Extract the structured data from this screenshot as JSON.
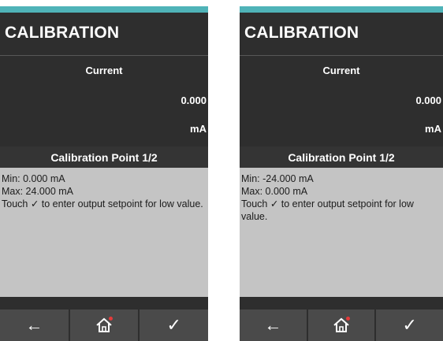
{
  "screens": [
    {
      "title": "CALIBRATION",
      "current_label": "Current",
      "current_value": "0.000",
      "current_unit": "mA",
      "calibration_point": "Calibration Point 1/2",
      "info": {
        "min": "Min: 0.000 mA",
        "max": "Max: 24.000 mA",
        "instruction": "Touch ✓ to enter output setpoint for low value."
      }
    },
    {
      "title": "CALIBRATION",
      "current_label": "Current",
      "current_value": "0.000",
      "current_unit": "mA",
      "calibration_point": "Calibration Point 1/2",
      "info": {
        "min": "Min: -24.000 mA",
        "max": "Max: 0.000 mA",
        "instruction": "Touch ✓ to enter output setpoint for low value."
      }
    }
  ],
  "nav": {
    "back_icon": "←",
    "home_icon": "home-icon",
    "confirm_icon": "✓"
  },
  "colors": {
    "accent": "#4fb3b8",
    "background": "#2e2e2e",
    "panel": "#c4c4c4",
    "notification_dot": "#e33b3b"
  }
}
